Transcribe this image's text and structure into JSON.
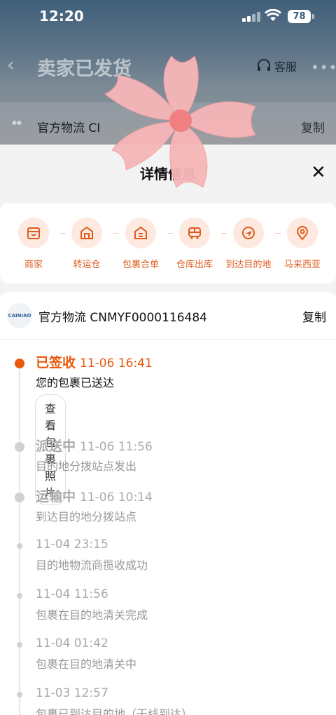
{
  "status_bar": {
    "time": "12:20",
    "battery": "78"
  },
  "header": {
    "back_icon": "chevron-left-icon",
    "title": "卖家已发货",
    "service_label": "客服",
    "more_icon": "more-icon"
  },
  "background_card": {
    "title": "官方物流 CI",
    "copy_label": "复制"
  },
  "sheet": {
    "title": "详情信息",
    "close_label": "✕"
  },
  "route": [
    {
      "label": "商家",
      "icon": "store-icon"
    },
    {
      "label": "转运仓",
      "icon": "warehouse-icon"
    },
    {
      "label": "包裹合单",
      "icon": "warehouse-icon"
    },
    {
      "label": "仓库出库",
      "icon": "truck-icon"
    },
    {
      "label": "到达目的地",
      "icon": "plane-icon"
    },
    {
      "label": "马来西亚",
      "icon": "location-pin-icon"
    }
  ],
  "carrier": {
    "name": "官方物流 CNMYF0000116484",
    "copy_label": "复制"
  },
  "timeline": [
    {
      "status": "已签收",
      "time": "11-06 16:41",
      "desc": "您的包裹已送达",
      "active": true,
      "button": "查看包裹照片"
    },
    {
      "status": "派送中",
      "time": "11-06 11:56",
      "desc": "目的地分拨站点发出",
      "active": false
    },
    {
      "status": "运输中",
      "time": "11-06 10:14",
      "desc": "到达目的地分拨站点",
      "active": false
    },
    {
      "status": "",
      "time": "11-04 23:15",
      "desc": "目的地物流商揽收成功",
      "active": false
    },
    {
      "status": "",
      "time": "11-04 11:56",
      "desc": "包裹在目的地清关完成",
      "active": false
    },
    {
      "status": "",
      "time": "11-04 01:42",
      "desc": "包裹在目的地清关中",
      "active": false
    },
    {
      "status": "",
      "time": "11-03 12:57",
      "desc": "包裹已到达目的地（干线到达）",
      "active": false
    }
  ]
}
